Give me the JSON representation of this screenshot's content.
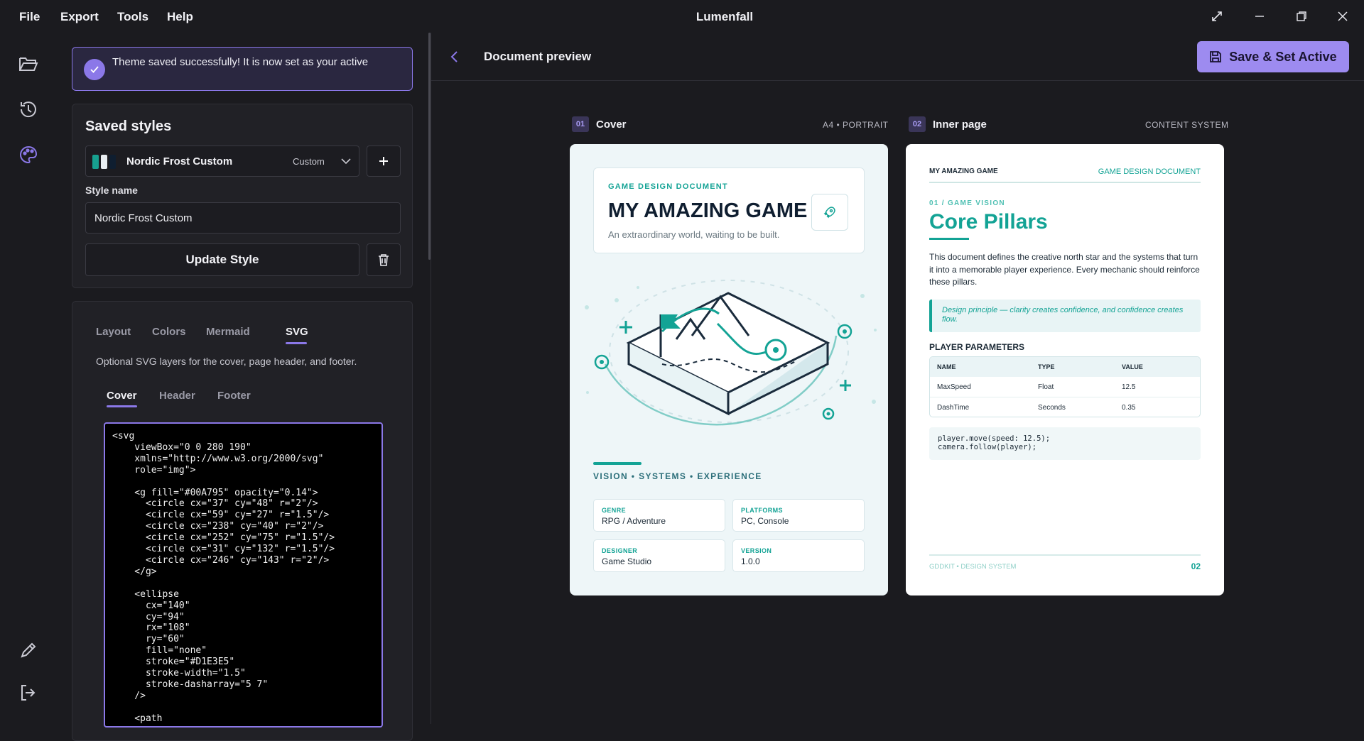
{
  "titlebar": {
    "menus": [
      "File",
      "Export",
      "Tools",
      "Help"
    ],
    "app_title": "Lumenfall"
  },
  "toast": {
    "message": "Theme saved successfully! It is now set as your active"
  },
  "saved_styles": {
    "title": "Saved styles",
    "selected_style": "Nordic Frost Custom",
    "selected_tag": "Custom",
    "swatch_colors": [
      "#17a08f",
      "#e9eef2",
      "#0f1e30"
    ],
    "style_name_label": "Style name",
    "style_name_value": "Nordic Frost Custom",
    "update_label": "Update Style"
  },
  "editor": {
    "tabs": [
      "Layout",
      "Colors",
      "Mermaid",
      "SVG"
    ],
    "active_tab": "SVG",
    "description": "Optional SVG layers for the cover, page header, and footer.",
    "subtabs": [
      "Cover",
      "Header",
      "Footer"
    ],
    "active_subtab": "Cover",
    "code": "<svg\n    viewBox=\"0 0 280 190\"\n    xmlns=\"http://www.w3.org/2000/svg\"\n    role=\"img\">\n\n    <g fill=\"#00A795\" opacity=\"0.14\">\n      <circle cx=\"37\" cy=\"48\" r=\"2\"/>\n      <circle cx=\"59\" cy=\"27\" r=\"1.5\"/>\n      <circle cx=\"238\" cy=\"40\" r=\"2\"/>\n      <circle cx=\"252\" cy=\"75\" r=\"1.5\"/>\n      <circle cx=\"31\" cy=\"132\" r=\"1.5\"/>\n      <circle cx=\"246\" cy=\"143\" r=\"2\"/>\n    </g>\n\n    <ellipse\n      cx=\"140\"\n      cy=\"94\"\n      rx=\"108\"\n      ry=\"60\"\n      fill=\"none\"\n      stroke=\"#D1E3E5\"\n      stroke-width=\"1.5\"\n      stroke-dasharray=\"5 7\"\n    />\n\n    <path"
  },
  "preview": {
    "title": "Document preview",
    "save_label": "Save & Set Active",
    "accent": "#9d8bf0",
    "pages": [
      {
        "num": "01",
        "label": "Cover",
        "meta": "A4 • PORTRAIT"
      },
      {
        "num": "02",
        "label": "Inner page",
        "meta": "CONTENT SYSTEM"
      }
    ]
  },
  "cover": {
    "eyebrow": "GAME DESIGN DOCUMENT",
    "title": "MY AMAZING GAME",
    "subtitle": "An extraordinary world, waiting to be built.",
    "tagline": "VISION • SYSTEMS • EXPERIENCE",
    "fields": [
      {
        "key": "GENRE",
        "value": "RPG / Adventure"
      },
      {
        "key": "PLATFORMS",
        "value": "PC, Console"
      },
      {
        "key": "DESIGNER",
        "value": "Game Studio"
      },
      {
        "key": "VERSION",
        "value": "1.0.0"
      }
    ],
    "accent": "#13a395"
  },
  "inner": {
    "header_left": "MY AMAZING GAME",
    "header_right": "GAME DESIGN DOCUMENT",
    "eyebrow": "01 / GAME VISION",
    "title": "Core Pillars",
    "body": "This document defines the creative north star and the systems that turn it into a memorable player experience. Every mechanic should reinforce these pillars.",
    "quote": "Design principle — clarity creates confidence, and confidence creates flow.",
    "params_title": "PLAYER PARAMETERS",
    "table_headers": [
      "NAME",
      "TYPE",
      "VALUE"
    ],
    "table_rows": [
      [
        "MaxSpeed",
        "Float",
        "12.5"
      ],
      [
        "DashTime",
        "Seconds",
        "0.35"
      ]
    ],
    "code": "player.move(speed: 12.5);\ncamera.follow(player);",
    "footer_left": "GDDKIT • DESIGN SYSTEM",
    "footer_right": "02"
  }
}
